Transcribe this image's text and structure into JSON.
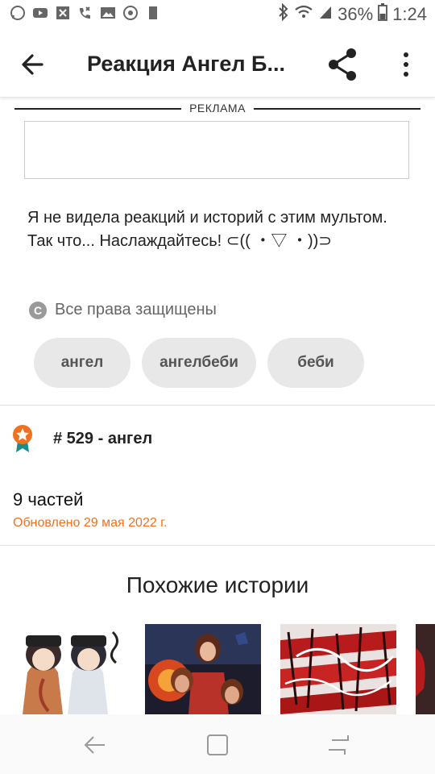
{
  "status_bar": {
    "battery": "36%",
    "time": "1:24",
    "left_icons": [
      "whatsapp-icon",
      "youtube-icon",
      "x-close-icon",
      "missed-call-icon",
      "image-icon",
      "target-icon",
      "sd-card-icon"
    ],
    "right_icons": [
      "bluetooth-icon",
      "wifi-icon",
      "signal-icon",
      "battery-icon"
    ]
  },
  "toolbar": {
    "title": "Реакция Ангел Б...",
    "back_icon": "back-arrow-icon",
    "share_icon": "share-icon",
    "more_icon": "more-vertical-icon"
  },
  "ad": {
    "label": "РЕКЛАМА"
  },
  "description": "Я не видела реакций и историй с этим мультом. Так что... Наслаждайтесь! ⊂(( ・▽ ・))⊃",
  "copyright": {
    "icon": "copyright-icon",
    "text": "Все права защищены"
  },
  "tags": [
    "ангел",
    "ангелбеби",
    "беби"
  ],
  "ranking": {
    "icon": "medal-icon",
    "text": "# 529 - ангел"
  },
  "parts": {
    "count_text": "9 частей",
    "updated_text": "Обновлено 29 мая 2022 г."
  },
  "similar": {
    "heading": "Похожие истории",
    "covers": [
      "cover-anime-twins",
      "cover-fire-heroes",
      "cover-red-love-art",
      "cover-partial"
    ]
  },
  "colors": {
    "accent": "#f07120",
    "tag_bg": "#e8e8e8",
    "text": "#222222"
  },
  "navbar": {
    "icons": [
      "nav-back-icon",
      "nav-home-icon",
      "nav-recents-icon"
    ]
  }
}
